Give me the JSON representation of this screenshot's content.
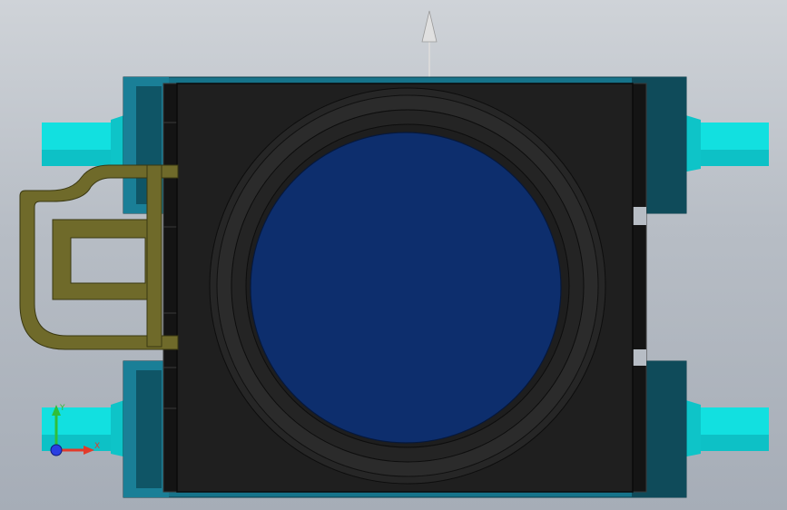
{
  "viewport": {
    "background_top": "#cfd3d8",
    "background_bottom": "#a6adb7"
  },
  "model": {
    "body_color": "#1f1f1f",
    "bracket_color": "#16738a",
    "bracket_dark": "#0f4b5a",
    "pipe_color": "#12e0e0",
    "pipe_shade": "#0aa7b0",
    "wire_color": "#6f6a2a",
    "lens_color": "#0d2e6d",
    "ring_color": "#2a2a2a"
  },
  "triad": {
    "x_label": "X",
    "y_label": "Y",
    "x_color": "#e23a2a",
    "y_color": "#2fbf3a",
    "z_color": "#2a3fe2"
  },
  "direction_arrow": {
    "color": "#d9d9d9"
  }
}
